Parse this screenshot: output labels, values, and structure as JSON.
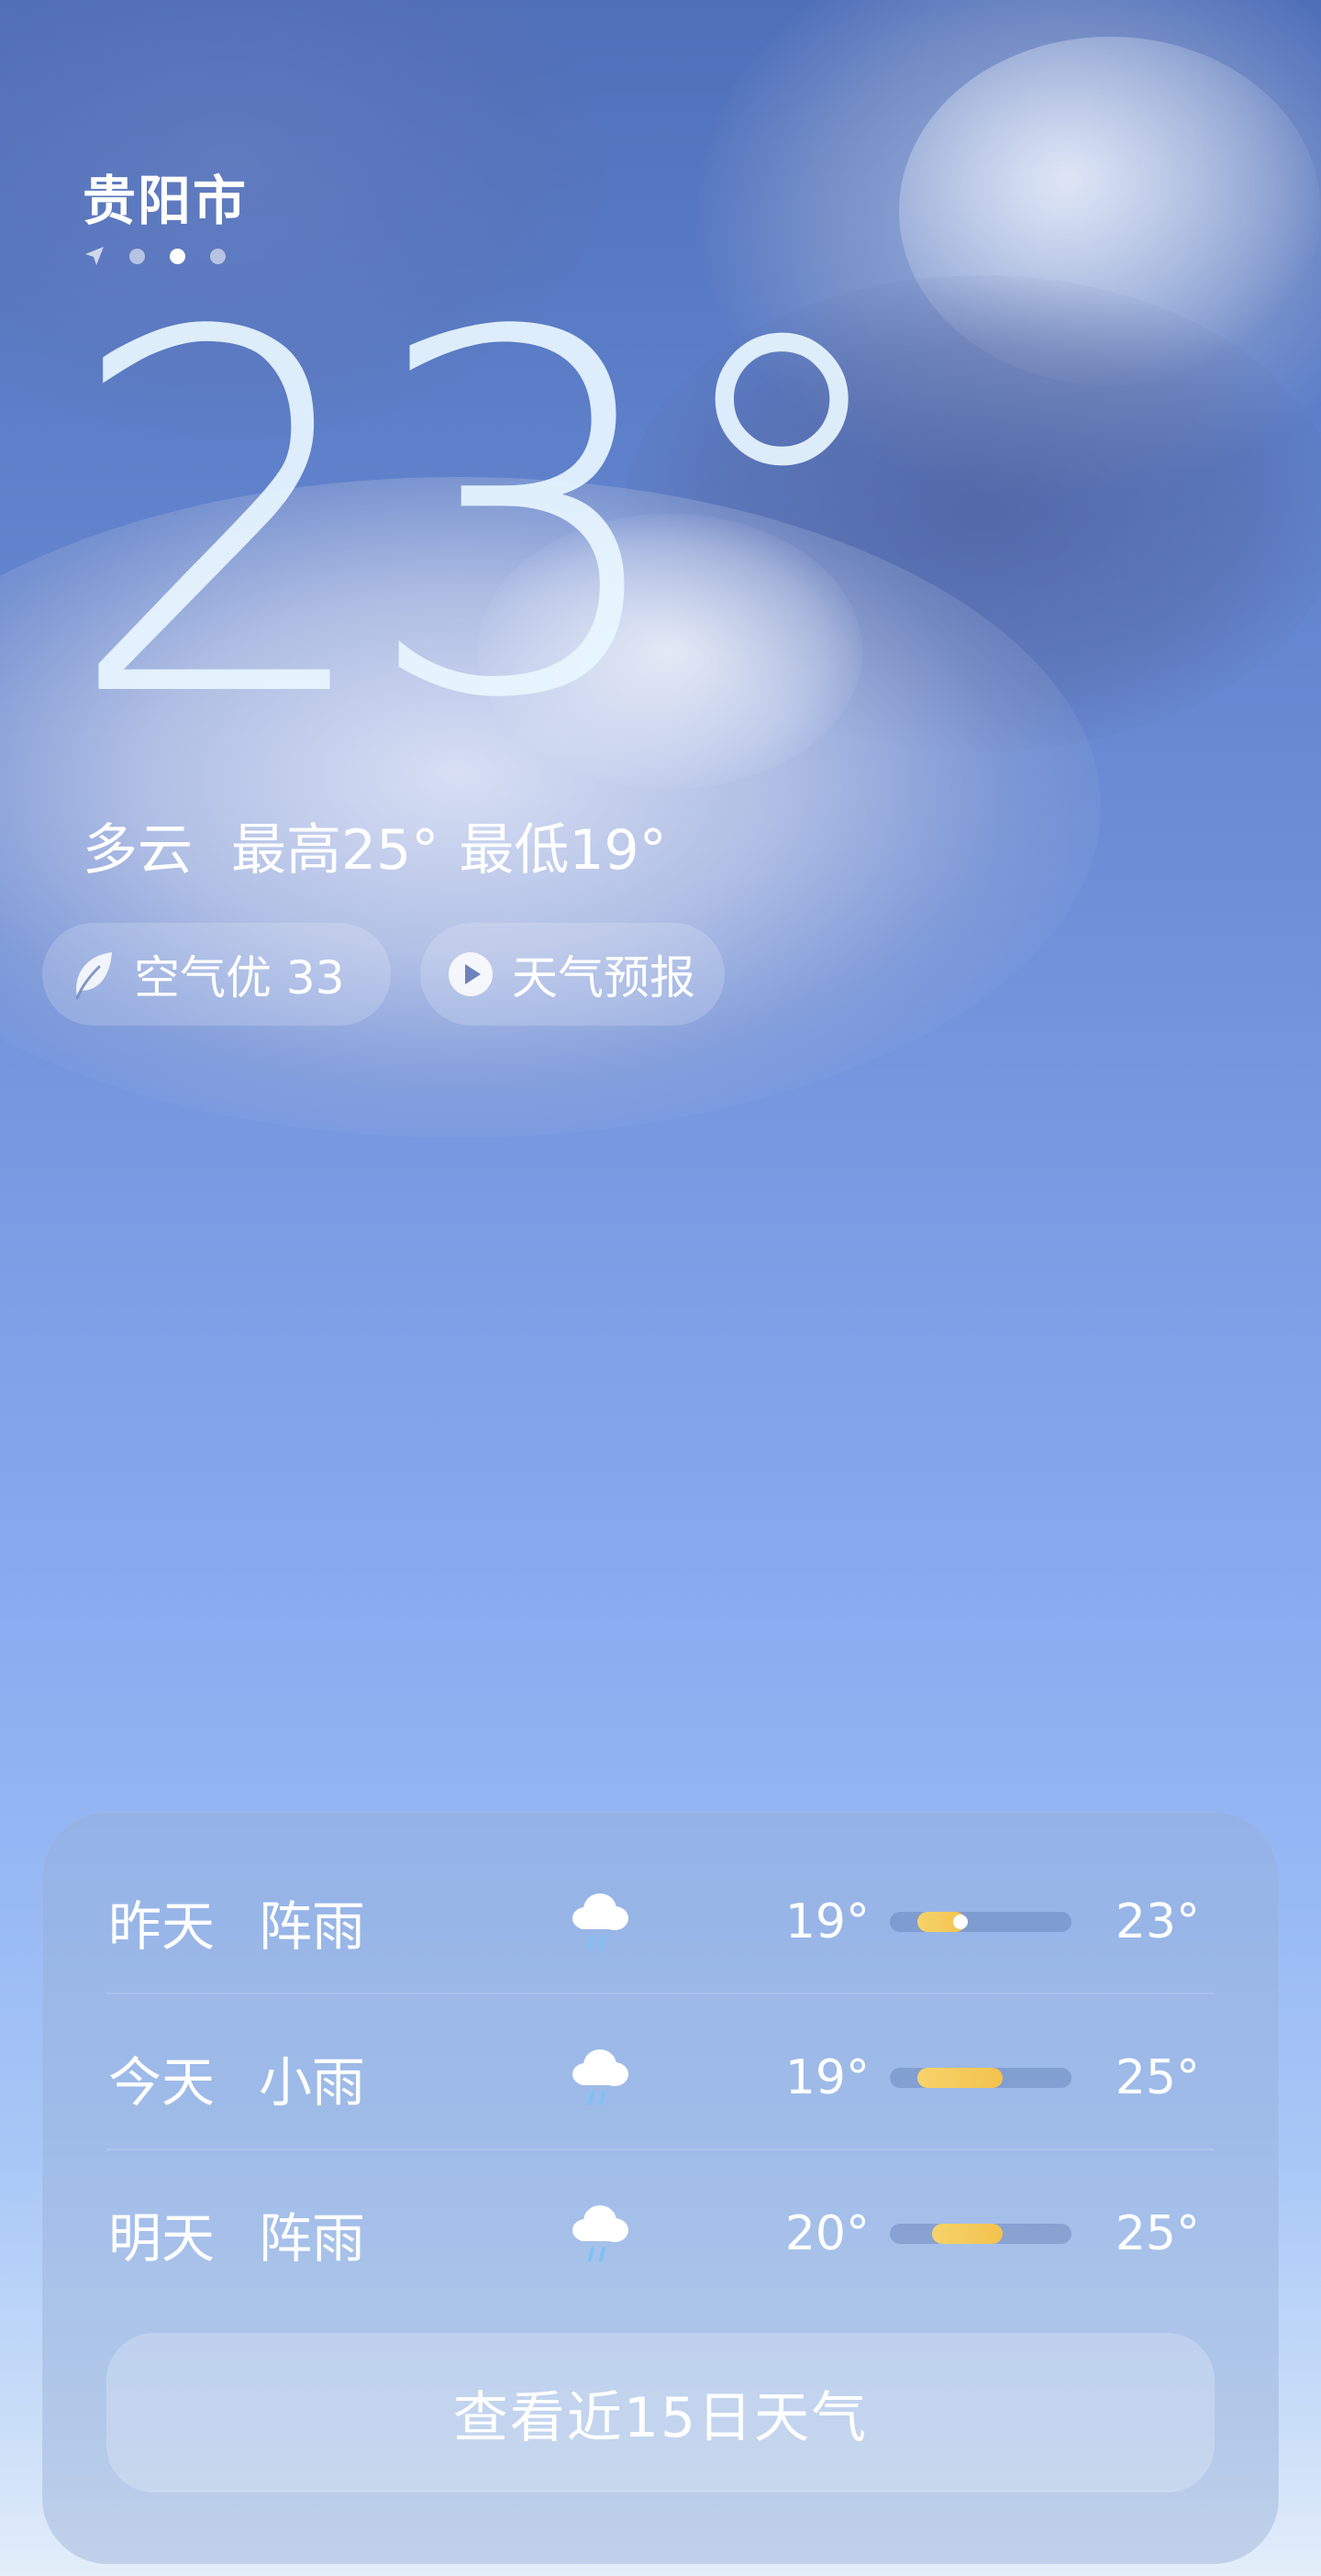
{
  "location": {
    "city": "贵阳市",
    "page_dots": [
      "location-arrow",
      "dot",
      "dot-active",
      "dot"
    ]
  },
  "current": {
    "temperature": "23°",
    "condition": "多云",
    "high": "最高25°",
    "low": "最低19°"
  },
  "pills": {
    "air_quality": "空气优 33",
    "forecast": "天气预报"
  },
  "daily": [
    {
      "day": "昨天",
      "condition": "阵雨",
      "icon": "shower-rain-icon",
      "low": "19°",
      "high": "23°",
      "range_start": 0.15,
      "range_end": 0.42,
      "current_marker": 0.39
    },
    {
      "day": "今天",
      "condition": "小雨",
      "icon": "light-rain-icon",
      "low": "19°",
      "high": "25°",
      "range_start": 0.15,
      "range_end": 0.62
    },
    {
      "day": "明天",
      "condition": "阵雨",
      "icon": "shower-rain-icon",
      "low": "20°",
      "high": "25°",
      "range_start": 0.23,
      "range_end": 0.62
    }
  ],
  "more_button": "查看近15日天气",
  "colors": {
    "bar_fill": "#f3c24e",
    "text": "#ffffff",
    "rain_drop": "#7dc2f5"
  }
}
